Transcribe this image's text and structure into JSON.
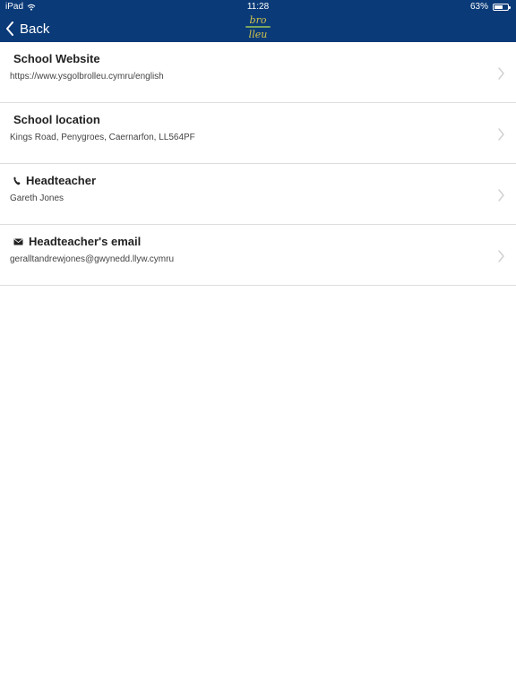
{
  "status_bar": {
    "device": "iPad",
    "time": "11:28",
    "battery": "63%",
    "battery_level": 0.63,
    "icons": [
      "wifi-icon",
      "battery-icon"
    ]
  },
  "navbar": {
    "back_label": "Back",
    "logo_text_top": "bro",
    "logo_text_bottom": "lleu",
    "background_color": "#0a3a78"
  },
  "items": [
    {
      "title": "School Website",
      "value": "https://www.ysgolbrolleu.cymru/english"
    },
    {
      "title": "School location",
      "value": "Kings Road, Penygroes, Caernarfon, LL564PF"
    },
    {
      "title": "Headteacher",
      "value": "Gareth Jones",
      "icon": "phone-icon"
    },
    {
      "title": "Headteacher's email",
      "value": "geralltandrewjones@gwynedd.llyw.cymru",
      "icon": "envelope-icon"
    }
  ]
}
